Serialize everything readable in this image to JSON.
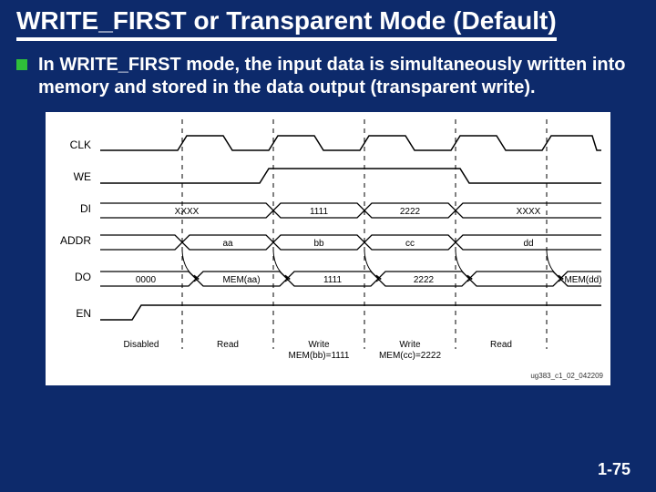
{
  "title": "WRITE_FIRST or Transparent Mode (Default)",
  "bullet": "In WRITE_FIRST mode, the input data is simultaneously written into memory and stored in the data output (transparent write).",
  "page_number": "1-75",
  "diagram": {
    "signal_labels": {
      "clk": "CLK",
      "we": "WE",
      "di": "DI",
      "addr": "ADDR",
      "do": "DO",
      "en": "EN"
    },
    "di": {
      "c0": "XXXX",
      "c1": "1111",
      "c2": "2222",
      "c3": "XXXX"
    },
    "addr": {
      "c0": "aa",
      "c1": "bb",
      "c2": "cc",
      "c3": "dd"
    },
    "do": {
      "pre": "0000",
      "c0": "MEM(aa)",
      "c1": "1111",
      "c2": "2222",
      "c3": "MEM(dd)"
    },
    "cols": {
      "c_pre": "Disabled",
      "c0": "Read",
      "c1a": "Write",
      "c1b": "MEM(bb)=1111",
      "c2a": "Write",
      "c2b": "MEM(cc)=2222",
      "c3": "Read"
    },
    "doc_id": "ug383_c1_02_042209"
  }
}
